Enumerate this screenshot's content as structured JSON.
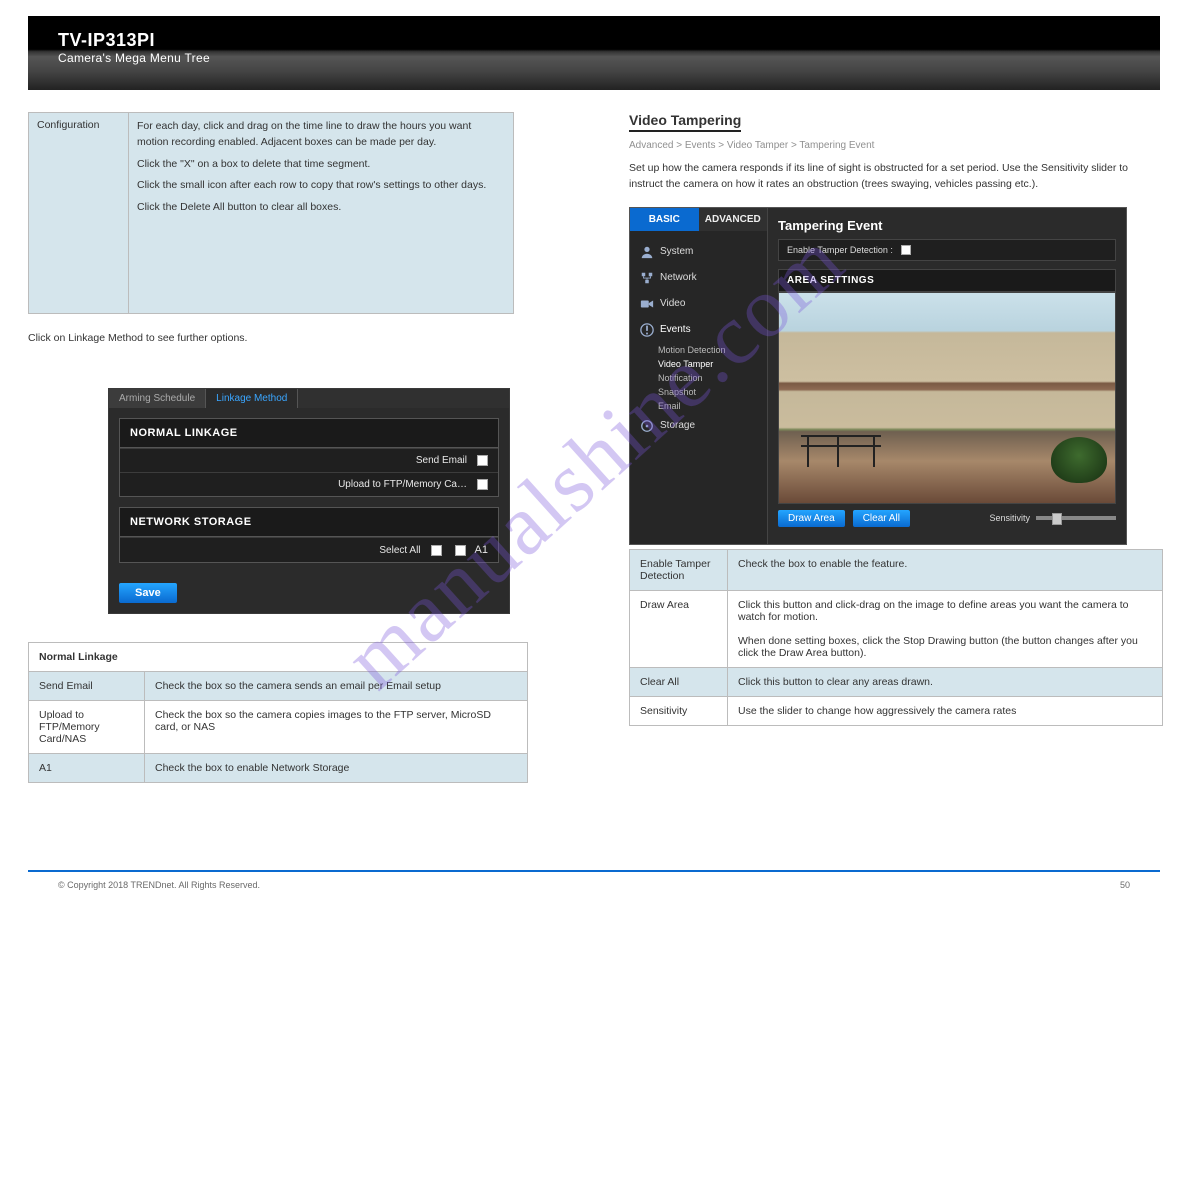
{
  "header": {
    "model": "TV-IP313PI",
    "subtitle": "Camera's Mega Menu Tree"
  },
  "left": {
    "cfg": {
      "label": "Configuration",
      "text1": "For each day, click and drag on the time line to draw the hours you want motion recording enabled. Adjacent boxes can be made per day.",
      "text2": "Click the \"X\" on a box to delete that time segment.",
      "text3": "Click the small icon after each row to copy that row's settings to other days.",
      "text4": "Click the Delete All button to clear all boxes."
    },
    "linkage_caption": "Click on Linkage Method to see further options.",
    "linkage_shot": {
      "tabs": {
        "arming": "Arming Schedule",
        "linkage": "Linkage Method"
      },
      "panel1_title": "NORMAL LINKAGE",
      "rows": {
        "email": "Send Email",
        "upload": "Upload to FTP/Memory Ca…"
      },
      "panel2_title": "NETWORK STORAGE",
      "select_all": "Select All",
      "a1": "A1",
      "save": "Save"
    },
    "tbl": {
      "title": "Normal Linkage",
      "r1a": "Send Email",
      "r1b": "Check the box so the camera sends an email per Email setup",
      "r2a": "Upload to FTP/Memory Card/NAS",
      "r2b": "Check the box so the camera copies images to the FTP server, MicroSD card, or NAS",
      "r3a": "A1",
      "r3b": "Check the box to enable Network Storage"
    }
  },
  "right": {
    "heading": "Video Tampering",
    "crumbs": "Advanced > Events > Video Tamper > Tampering Event",
    "blurb": "Set up how the camera responds if its line of sight is obstructed for a set period. Use the Sensitivity slider to instruct the camera on how it rates an obstruction (trees swaying, vehicles passing etc.).",
    "ui": {
      "tabs": {
        "basic": "BASIC",
        "advanced": "ADVANCED"
      },
      "nav": {
        "system": "System",
        "network": "Network",
        "video": "Video",
        "events": "Events",
        "subs": [
          "Motion Detection",
          "Video Tamper",
          "Notification",
          "Snapshot",
          "Email"
        ],
        "storage": "Storage"
      },
      "title": "Tampering Event",
      "enable": "Enable Tamper Detection :",
      "area": "AREA SETTINGS",
      "draw": "Draw Area",
      "clear": "Clear All",
      "sensitivity": "Sensitivity"
    },
    "tbl": {
      "r1a": "Enable Tamper Detection",
      "r1b": "Check the box to enable the feature.",
      "r2a": "Draw Area",
      "r2b1": "Click this button and click-drag on the image to define areas you want the camera to watch for motion.",
      "r2b2": "When done setting boxes, click the Stop Drawing button (the button changes after you click the Draw Area button).",
      "r3a": "Clear All",
      "r3b": "Click this button to clear any areas drawn.",
      "r4a": "Sensitivity",
      "r4b": "Use the slider to change how aggressively the camera rates"
    }
  },
  "footer": {
    "copy": "© Copyright 2018 TRENDnet. All Rights Reserved.",
    "page": "50"
  },
  "watermark": "manualshine.com"
}
